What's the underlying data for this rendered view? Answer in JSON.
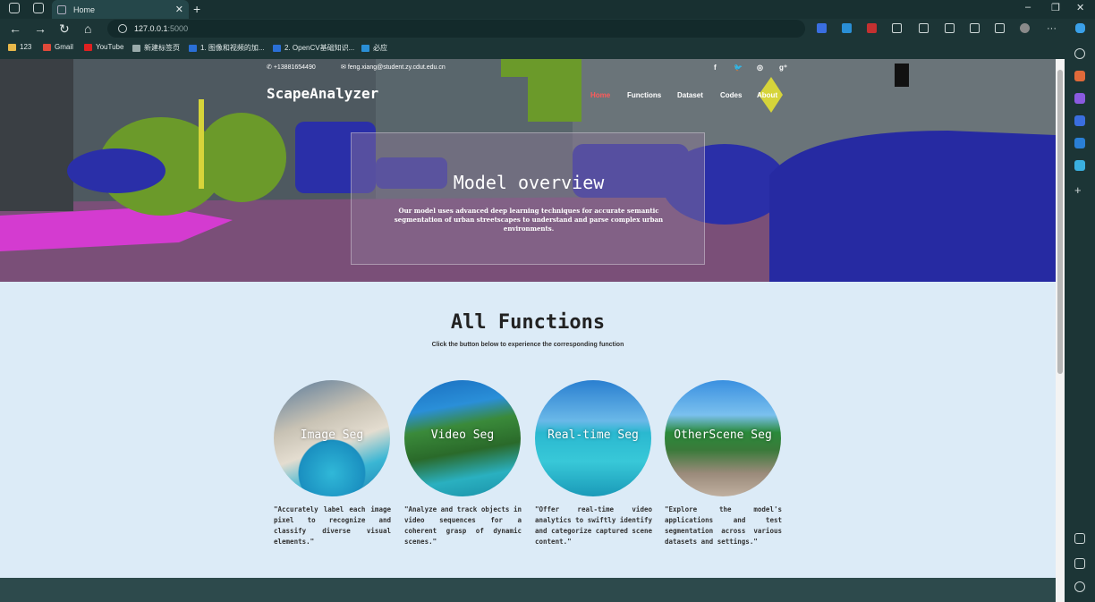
{
  "browser": {
    "tab_title": "Home",
    "tab_close": "✕",
    "new_tab": "+",
    "url_host": "127.0.0.1",
    "url_port": ":5000",
    "window_min": "–",
    "window_max": "❐",
    "window_close": "✕"
  },
  "bookmarks": [
    {
      "label": "123",
      "icon_color": "#e8b84a"
    },
    {
      "label": "Gmail",
      "icon_color": "#e04a3a"
    },
    {
      "label": "YouTube",
      "icon_color": "#e02020"
    },
    {
      "label": "新建标签页",
      "icon_color": "#9aa"
    },
    {
      "label": "1. 图像和视频的加...",
      "icon_color": "#2a6fd6"
    },
    {
      "label": "2. OpenCV基础知识...",
      "icon_color": "#2a6fd6"
    },
    {
      "label": "必应",
      "icon_color": "#2a8fd6"
    }
  ],
  "site": {
    "phone": "+13881654490",
    "email": "feng.xiang@student.zy.cdut.edu.cn",
    "social": [
      "f",
      "🐦",
      "◎",
      "g⁺"
    ],
    "brand": "ScapeAnalyzer",
    "menu": [
      "Home",
      "Functions",
      "Dataset",
      "Codes",
      "About"
    ],
    "hero_title": "Model overview",
    "hero_text": "Our model uses advanced deep learning techniques for accurate semantic segmentation of urban streetscapes to understand and parse complex urban environments."
  },
  "functions": {
    "title": "All Functions",
    "subtitle": "Click the button below to experience the corresponding function",
    "cards": [
      {
        "label": "Image Seg",
        "desc": "\"Accurately label each image pixel to recognize and classify diverse visual elements.\""
      },
      {
        "label": "Video Seg",
        "desc": "\"Analyze and track objects in video sequences for a coherent grasp of dynamic scenes.\""
      },
      {
        "label": "Real-time Seg",
        "desc": "\"Offer real-time video analytics to swiftly identify and categorize captured scene content.\""
      },
      {
        "label": "OtherScene Seg",
        "desc": "\"Explore the model's applications and test segmentation across various datasets and settings.\""
      }
    ]
  },
  "colors": {
    "menu_active": "#ff5a5a",
    "seg_car": "#2a2fa8",
    "seg_road": "#7a4f78",
    "seg_veg": "#6b9a2a",
    "seg_sidewalk": "#d43bd0"
  }
}
